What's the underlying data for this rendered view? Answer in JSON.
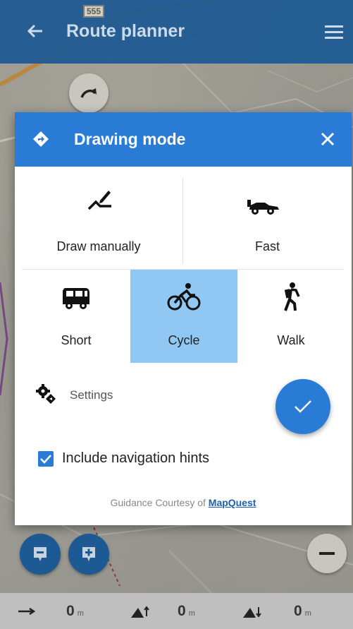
{
  "topbar": {
    "title": "Route planner",
    "back_icon": "arrow-left-icon",
    "menu_icon": "hamburger-menu-icon",
    "road_badge": "555"
  },
  "dialog": {
    "title": "Drawing mode",
    "header_icon": "route-diamond-icon",
    "close_icon": "close-icon",
    "modes": [
      {
        "label": "Draw manually",
        "icon": "draw-pencil-icon"
      },
      {
        "label": "Fast",
        "icon": "race-car-icon"
      },
      {
        "label": "Short",
        "icon": "van-icon"
      },
      {
        "label": "Cycle",
        "icon": "bicycle-icon",
        "selected": true
      },
      {
        "label": "Walk",
        "icon": "hiker-icon"
      }
    ],
    "settings_label": "Settings",
    "confirm_icon": "check-icon",
    "include_hints_label": "Include navigation hints",
    "include_hints_checked": true,
    "credit_prefix": "Guidance Courtesy of ",
    "credit_link": "MapQuest"
  },
  "stats": [
    {
      "icon": "arrow-right-icon",
      "value": "0",
      "unit": "m"
    },
    {
      "icon": "elevation-up-icon",
      "value": "0",
      "unit": "m"
    },
    {
      "icon": "elevation-down-icon",
      "value": "0",
      "unit": "m"
    }
  ],
  "colors": {
    "topbar": "#1d5a93",
    "dialog_header": "#2a7bd6",
    "selected_mode": "#90c8f3",
    "fab": "#2a7bd6"
  }
}
